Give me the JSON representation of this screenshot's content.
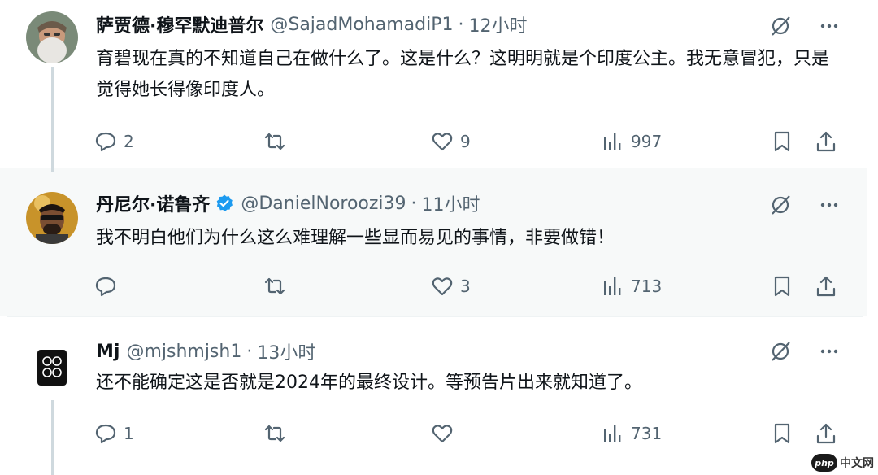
{
  "tweets": [
    {
      "display_name": "萨贾德·穆罕默迪普尔",
      "handle": "@SajadMohamadiP1",
      "separator": "·",
      "time": "12小时",
      "verified": false,
      "text": "育碧现在真的不知道自己在做什么了。这是什么？这明明就是个印度公主。我无意冒犯，只是觉得她长得像印度人。",
      "replies": "2",
      "retweets": "",
      "likes": "9",
      "views": "997"
    },
    {
      "display_name": "丹尼尔·诺鲁齐",
      "handle": "@DanielNoroozi39",
      "separator": "·",
      "time": "11小时",
      "verified": true,
      "text": "我不明白他们为什么这么难理解一些显而易见的事情，非要做错！",
      "replies": "",
      "retweets": "",
      "likes": "3",
      "views": "713"
    },
    {
      "display_name": "Mj",
      "handle": "@mjshmjsh1",
      "separator": "·",
      "time": "13小时",
      "verified": false,
      "text": "还不能确定这是否就是2024年的最终设计。等预告片出来就知道了。",
      "replies": "1",
      "retweets": "",
      "likes": "",
      "views": "731"
    }
  ],
  "icons": [
    "grok-icon",
    "more-icon",
    "reply-icon",
    "retweet-icon",
    "like-icon",
    "views-icon",
    "bookmark-icon",
    "share-icon",
    "verified-badge-icon"
  ],
  "colors": {
    "text": "#0f1419",
    "secondary": "#536471",
    "verified": "#1d9bf0",
    "thread_line": "#cfd9de"
  },
  "watermark": {
    "logo": "php",
    "text": "中文网"
  }
}
